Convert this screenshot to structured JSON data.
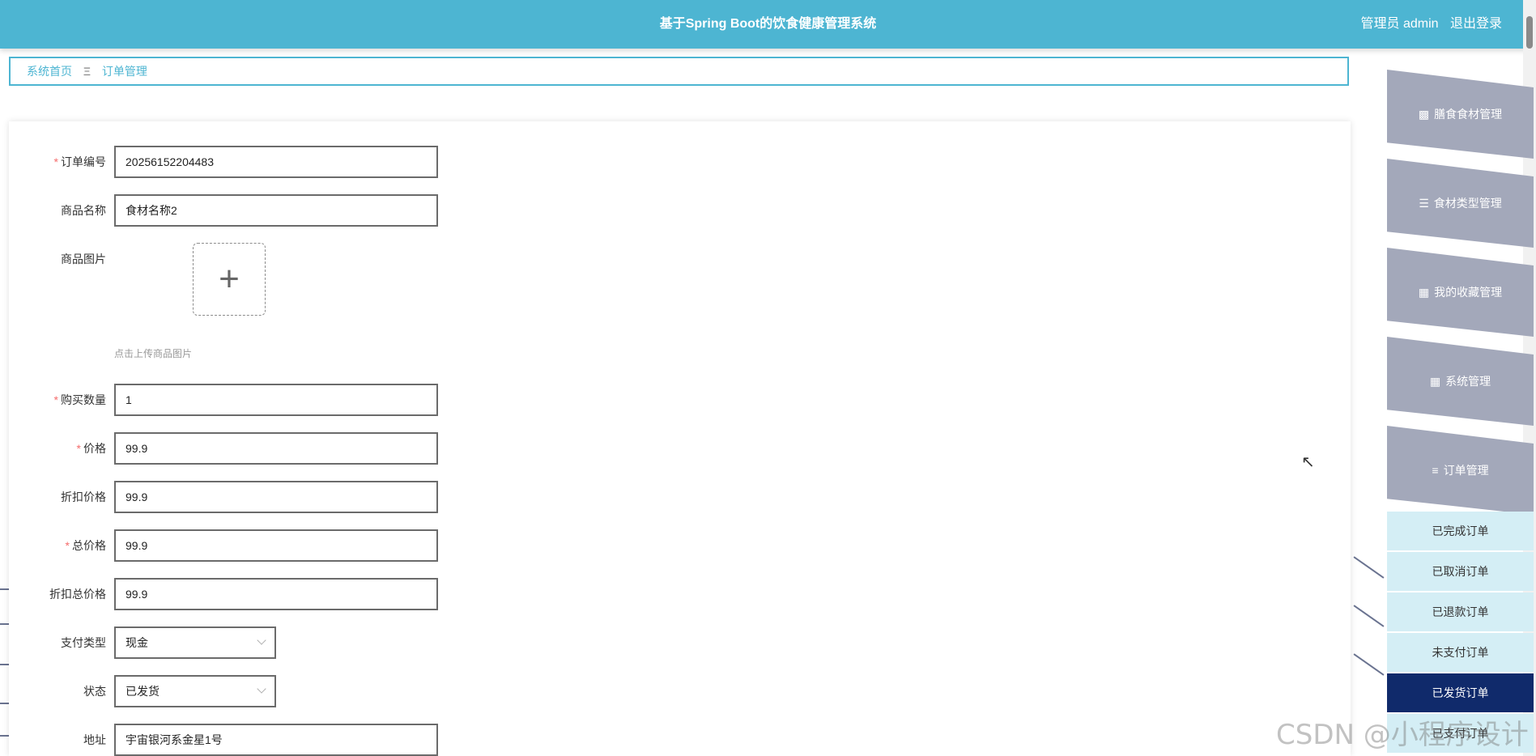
{
  "header": {
    "title": "基于Spring Boot的饮食健康管理系统",
    "user_label": "管理员 admin",
    "logout_label": "退出登录"
  },
  "breadcrumb": {
    "home": "系统首页",
    "separator": "Ξ",
    "current": "订单管理"
  },
  "form": {
    "order_no": {
      "label": "订单编号",
      "value": "20256152204483"
    },
    "product_name": {
      "label": "商品名称",
      "value": "食材名称2"
    },
    "product_image": {
      "label": "商品图片",
      "hint": "点击上传商品图片"
    },
    "quantity": {
      "label": "购买数量",
      "value": "1"
    },
    "price": {
      "label": "价格",
      "value": "99.9"
    },
    "discount_price": {
      "label": "折扣价格",
      "value": "99.9"
    },
    "total_price": {
      "label": "总价格",
      "value": "99.9"
    },
    "discount_total_price": {
      "label": "折扣总价格",
      "value": "99.9"
    },
    "pay_type": {
      "label": "支付类型",
      "value": "现金"
    },
    "status": {
      "label": "状态",
      "value": "已发货"
    },
    "address": {
      "label": "地址",
      "value": "宇宙银河系金星1号"
    }
  },
  "menu": {
    "items": [
      {
        "label": "膳食食材管理",
        "icon": "ticket-icon"
      },
      {
        "label": "食材类型管理",
        "icon": "list-icon"
      },
      {
        "label": "我的收藏管理",
        "icon": "clipboard-icon"
      },
      {
        "label": "系统管理",
        "icon": "grid-icon"
      },
      {
        "label": "订单管理",
        "icon": "sliders-icon"
      }
    ],
    "sub_items": [
      "已完成订单",
      "已取消订单",
      "已退款订单",
      "未支付订单",
      "已发货订单",
      "已支付订单"
    ]
  },
  "watermark": "CSDN @小程序设计",
  "colors": {
    "header_bg": "#4db5d2",
    "active_menu": "#102a6b"
  }
}
